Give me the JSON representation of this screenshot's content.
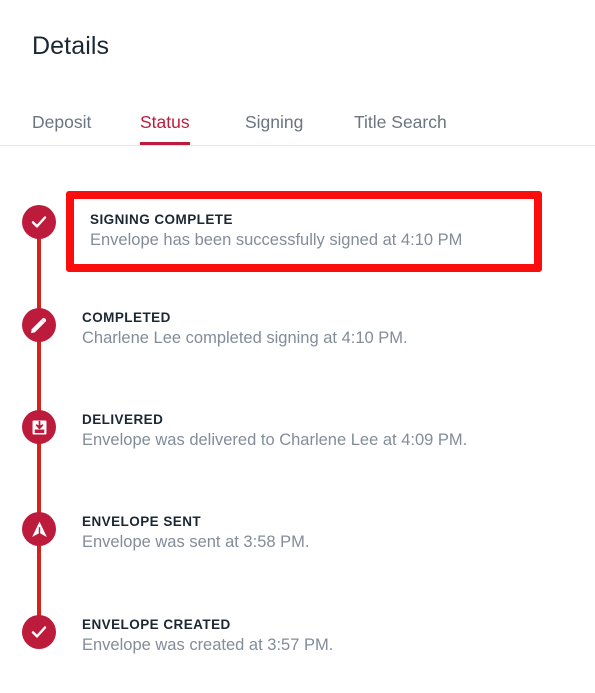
{
  "header": {
    "title": "Details"
  },
  "tabs": [
    {
      "label": "Deposit",
      "active": false
    },
    {
      "label": "Status",
      "active": true
    },
    {
      "label": "Signing",
      "active": false
    },
    {
      "label": "Title Search",
      "active": false
    }
  ],
  "timeline": {
    "items": [
      {
        "icon": "check-circle-icon",
        "title": "SIGNING COMPLETE",
        "description": "Envelope has been successfully signed at 4:10 PM",
        "highlighted": true
      },
      {
        "icon": "pencil-icon",
        "title": "COMPLETED",
        "description": "Charlene Lee completed signing at 4:10 PM.",
        "highlighted": false
      },
      {
        "icon": "inbox-download-icon",
        "title": "DELIVERED",
        "description": "Envelope was delivered to Charlene Lee at 4:09 PM.",
        "highlighted": false
      },
      {
        "icon": "paper-plane-icon",
        "title": "ENVELOPE SENT",
        "description": "Envelope was sent at 3:58 PM.",
        "highlighted": false
      },
      {
        "icon": "check-circle-icon",
        "title": "ENVELOPE CREATED",
        "description": "Envelope was created at 3:57 PM.",
        "highlighted": false
      }
    ]
  },
  "colors": {
    "brand_crimson": "#bd1b3c",
    "spine_red": "#d5231b",
    "highlight_red": "#fb0d0d",
    "title_text": "#1b2733",
    "muted_text": "#838c99",
    "tab_inactive": "#6b7480",
    "divider": "#e4e6e9"
  }
}
